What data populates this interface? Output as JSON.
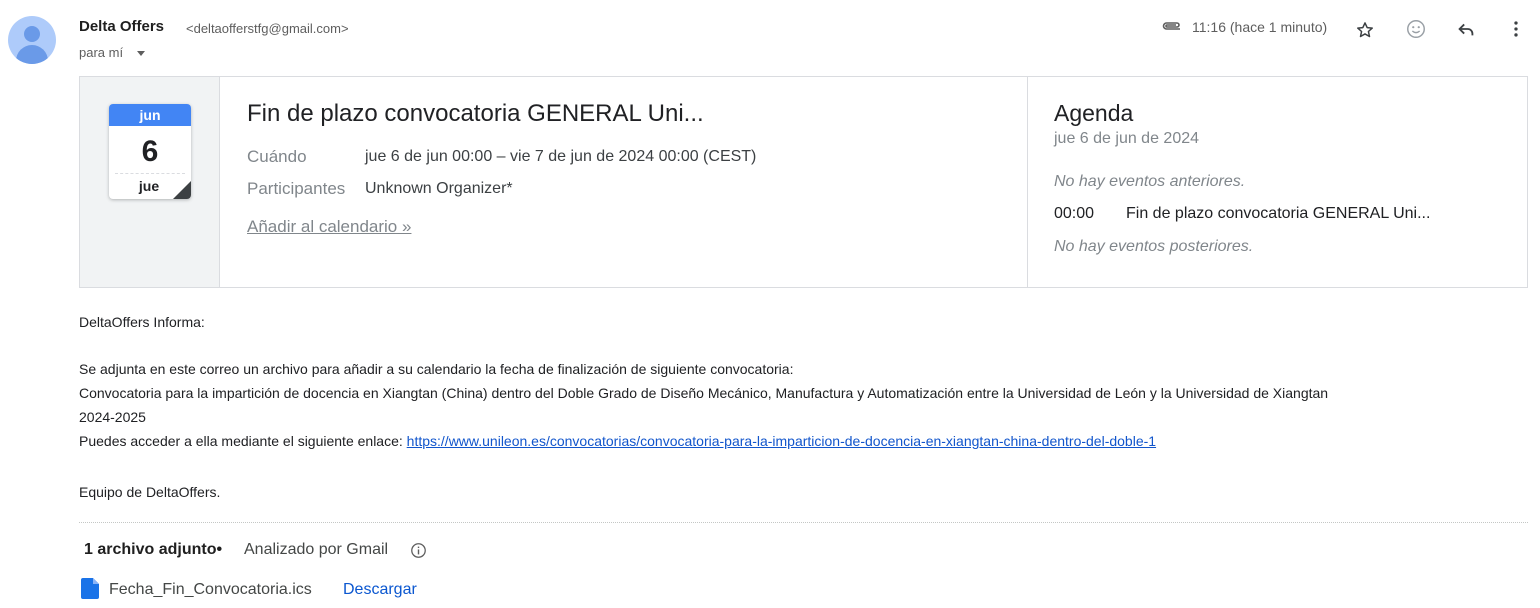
{
  "header": {
    "sender_name": "Delta Offers",
    "sender_email": "<deltaofferstfg@gmail.com>",
    "recipient": "para mí",
    "timestamp": "11:16 (hace 1 minuto)",
    "icons": [
      "attachment-clip-icon",
      "star-icon",
      "emoji-icon",
      "reply-icon",
      "more-vert-icon"
    ]
  },
  "invite": {
    "calendar": {
      "month": "jun",
      "day": "6",
      "weekday": "jue"
    },
    "title": "Fin de plazo convocatoria GENERAL Uni...",
    "when_label": "Cuándo",
    "when_value": "jue 6 de jun 00:00 – vie 7 de jun de 2024 00:00 (CEST)",
    "participants_label": "Participantes",
    "participants_value": "Unknown Organizer*",
    "add_to_calendar": "Añadir al calendario »"
  },
  "agenda": {
    "title": "Agenda",
    "date": "jue 6 de jun de 2024",
    "no_previous": "No hay eventos anteriores.",
    "event_time": "00:00",
    "event_title": "Fin de plazo convocatoria GENERAL Uni...",
    "no_next": "No hay eventos posteriores."
  },
  "body": {
    "greeting": "DeltaOffers Informa:",
    "line1": "Se adjunta en este correo un archivo para añadir a su calendario la fecha de finalización de siguiente convocatoria:",
    "line2": "Convocatoria para la impartición de docencia en Xiangtan (China) dentro del Doble Grado de Diseño Mecánico, Manufactura y Automatización entre la Universidad de León y la Universidad de Xiangtan",
    "line3": "2024-2025",
    "link_prefix": "Puedes acceder a ella mediante el siguiente enlace: ",
    "link_url": "https://www.unileon.es/convocatorias/convocatoria-para-la-imparticion-de-docencia-en-xiangtan-china-dentro-del-doble-1",
    "signature": "Equipo de DeltaOffers."
  },
  "attachments": {
    "count_label": "1 archivo adjunto",
    "separator": "•",
    "scanned_label": "Analizado por Gmail",
    "file_name": "Fecha_Fin_Convocatoria.ics",
    "download_label": "Descargar"
  },
  "colors": {
    "calendar_header": "#4285f4",
    "link": "#1155cc",
    "download": "#0b57d0",
    "file_icon": "#1a73e8",
    "avatar_bg": "#aecbfa"
  }
}
